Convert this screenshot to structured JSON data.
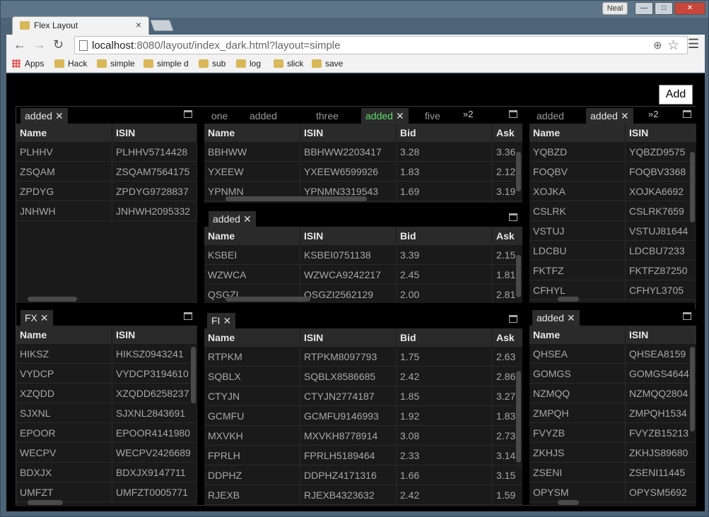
{
  "window": {
    "user": "Neal",
    "tab_title": "Flex Layout",
    "url_host": "localhost",
    "url_rest": ":8080/layout/index_dark.html?layout=simple"
  },
  "bookmarks": [
    "Apps",
    "Hack",
    "simple",
    "simple d",
    "sub",
    "log",
    "slick",
    "save"
  ],
  "add_button": "Add",
  "columns": {
    "name": "Name",
    "isin": "ISIN",
    "bid": "Bid",
    "ask": "Ask"
  },
  "tabsets": {
    "top_left": {
      "tabs": [
        {
          "label": "added"
        }
      ],
      "rows": [
        [
          "PLHHV",
          "PLHHV5714428"
        ],
        [
          "ZSQAM",
          "ZSQAM7564175"
        ],
        [
          "ZPDYG",
          "ZPDYG9728837"
        ],
        [
          "JNHWH",
          "JNHWH2095332"
        ]
      ]
    },
    "top_mid": {
      "tabs": [
        {
          "label": "one"
        },
        {
          "label": "added"
        },
        {
          "label": "three"
        },
        {
          "label": "added"
        },
        {
          "label": "five"
        }
      ],
      "overflow": "2",
      "rows": [
        [
          "BBHWW",
          "BBHWW2203417",
          "3.28",
          "3.36"
        ],
        [
          "YXEEW",
          "YXEEW6599926",
          "1.83",
          "2.12"
        ],
        [
          "YPNMN",
          "YPNMN3319543",
          "1.69",
          "3.19"
        ]
      ]
    },
    "mid_mid": {
      "tabs": [
        {
          "label": "added"
        }
      ],
      "rows": [
        [
          "KSBEI",
          "KSBEI0751138",
          "3.39",
          "2.15"
        ],
        [
          "WZWCA",
          "WZWCA9242217",
          "2.45",
          "1.81"
        ],
        [
          "QSGZI",
          "QSGZI2562129",
          "2.00",
          "2.81"
        ]
      ]
    },
    "top_right": {
      "tabs": [
        {
          "label": "added"
        },
        {
          "label": "added"
        }
      ],
      "overflow": "2",
      "rows": [
        [
          "YQBZD",
          "YQBZD9575"
        ],
        [
          "FOQBV",
          "FOQBV3368"
        ],
        [
          "XOJKA",
          "XOJKA6692"
        ],
        [
          "CSLRK",
          "CSLRK7659"
        ],
        [
          "VSTUJ",
          "VSTUJ81644"
        ],
        [
          "LDCBU",
          "LDCBU7233"
        ],
        [
          "FKTFZ",
          "FKTFZ87250"
        ],
        [
          "CFHYL",
          "CFHYL3705"
        ]
      ]
    },
    "bottom_left": {
      "tabs": [
        {
          "label": "FX"
        }
      ],
      "rows": [
        [
          "HIKSZ",
          "HIKSZ0943241"
        ],
        [
          "VYDCP",
          "VYDCP3194610"
        ],
        [
          "XZQDD",
          "XZQDD6258237"
        ],
        [
          "SJXNL",
          "SJXNL2843691"
        ],
        [
          "EPOOR",
          "EPOOR4141980"
        ],
        [
          "WECPV",
          "WECPV2426689"
        ],
        [
          "BDXJX",
          "BDXJX9147711"
        ],
        [
          "UMFZT",
          "UMFZT0005771"
        ]
      ]
    },
    "bottom_mid": {
      "tabs": [
        {
          "label": "FI"
        }
      ],
      "rows": [
        [
          "RTPKM",
          "RTPKM8097793",
          "1.75",
          "2.63"
        ],
        [
          "SQBLX",
          "SQBLX8586685",
          "2.42",
          "2.86"
        ],
        [
          "CTYJN",
          "CTYJN2774187",
          "1.85",
          "3.27"
        ],
        [
          "GCMFU",
          "GCMFU9146993",
          "1.92",
          "1.83"
        ],
        [
          "MXVKH",
          "MXVKH8778914",
          "3.08",
          "2.73"
        ],
        [
          "FPRLH",
          "FPRLH5189464",
          "2.33",
          "3.14"
        ],
        [
          "DDPHZ",
          "DDPHZ4171316",
          "1.66",
          "3.15"
        ],
        [
          "RJEXB",
          "RJEXB4323632",
          "2.42",
          "1.59"
        ]
      ]
    },
    "bottom_right": {
      "tabs": [
        {
          "label": "added"
        }
      ],
      "rows": [
        [
          "QHSEA",
          "QHSEA8159"
        ],
        [
          "GOMGS",
          "GOMGS4644"
        ],
        [
          "NZMQQ",
          "NZMQQ2804"
        ],
        [
          "ZMPQH",
          "ZMPQH1534"
        ],
        [
          "FVYZB",
          "FVYZB15213"
        ],
        [
          "ZKHJS",
          "ZKHJS89680"
        ],
        [
          "ZSENI",
          "ZSENI11445"
        ],
        [
          "OPYSM",
          "OPYSM5692"
        ]
      ]
    }
  }
}
